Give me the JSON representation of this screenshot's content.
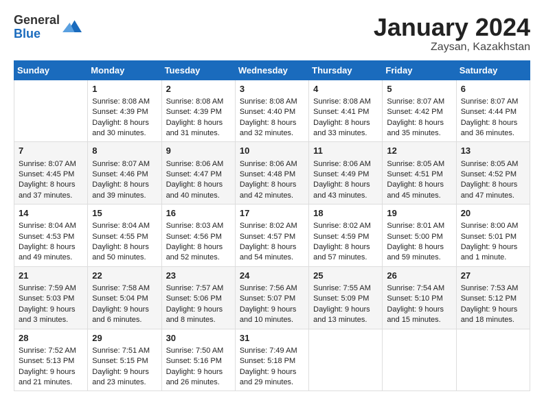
{
  "logo": {
    "general": "General",
    "blue": "Blue"
  },
  "title": "January 2024",
  "location": "Zaysan, Kazakhstan",
  "weekdays": [
    "Sunday",
    "Monday",
    "Tuesday",
    "Wednesday",
    "Thursday",
    "Friday",
    "Saturday"
  ],
  "weeks": [
    [
      {
        "day": "",
        "info": ""
      },
      {
        "day": "1",
        "info": "Sunrise: 8:08 AM\nSunset: 4:39 PM\nDaylight: 8 hours\nand 30 minutes."
      },
      {
        "day": "2",
        "info": "Sunrise: 8:08 AM\nSunset: 4:39 PM\nDaylight: 8 hours\nand 31 minutes."
      },
      {
        "day": "3",
        "info": "Sunrise: 8:08 AM\nSunset: 4:40 PM\nDaylight: 8 hours\nand 32 minutes."
      },
      {
        "day": "4",
        "info": "Sunrise: 8:08 AM\nSunset: 4:41 PM\nDaylight: 8 hours\nand 33 minutes."
      },
      {
        "day": "5",
        "info": "Sunrise: 8:07 AM\nSunset: 4:42 PM\nDaylight: 8 hours\nand 35 minutes."
      },
      {
        "day": "6",
        "info": "Sunrise: 8:07 AM\nSunset: 4:44 PM\nDaylight: 8 hours\nand 36 minutes."
      }
    ],
    [
      {
        "day": "7",
        "info": "Sunrise: 8:07 AM\nSunset: 4:45 PM\nDaylight: 8 hours\nand 37 minutes."
      },
      {
        "day": "8",
        "info": "Sunrise: 8:07 AM\nSunset: 4:46 PM\nDaylight: 8 hours\nand 39 minutes."
      },
      {
        "day": "9",
        "info": "Sunrise: 8:06 AM\nSunset: 4:47 PM\nDaylight: 8 hours\nand 40 minutes."
      },
      {
        "day": "10",
        "info": "Sunrise: 8:06 AM\nSunset: 4:48 PM\nDaylight: 8 hours\nand 42 minutes."
      },
      {
        "day": "11",
        "info": "Sunrise: 8:06 AM\nSunset: 4:49 PM\nDaylight: 8 hours\nand 43 minutes."
      },
      {
        "day": "12",
        "info": "Sunrise: 8:05 AM\nSunset: 4:51 PM\nDaylight: 8 hours\nand 45 minutes."
      },
      {
        "day": "13",
        "info": "Sunrise: 8:05 AM\nSunset: 4:52 PM\nDaylight: 8 hours\nand 47 minutes."
      }
    ],
    [
      {
        "day": "14",
        "info": "Sunrise: 8:04 AM\nSunset: 4:53 PM\nDaylight: 8 hours\nand 49 minutes."
      },
      {
        "day": "15",
        "info": "Sunrise: 8:04 AM\nSunset: 4:55 PM\nDaylight: 8 hours\nand 50 minutes."
      },
      {
        "day": "16",
        "info": "Sunrise: 8:03 AM\nSunset: 4:56 PM\nDaylight: 8 hours\nand 52 minutes."
      },
      {
        "day": "17",
        "info": "Sunrise: 8:02 AM\nSunset: 4:57 PM\nDaylight: 8 hours\nand 54 minutes."
      },
      {
        "day": "18",
        "info": "Sunrise: 8:02 AM\nSunset: 4:59 PM\nDaylight: 8 hours\nand 57 minutes."
      },
      {
        "day": "19",
        "info": "Sunrise: 8:01 AM\nSunset: 5:00 PM\nDaylight: 8 hours\nand 59 minutes."
      },
      {
        "day": "20",
        "info": "Sunrise: 8:00 AM\nSunset: 5:01 PM\nDaylight: 9 hours\nand 1 minute."
      }
    ],
    [
      {
        "day": "21",
        "info": "Sunrise: 7:59 AM\nSunset: 5:03 PM\nDaylight: 9 hours\nand 3 minutes."
      },
      {
        "day": "22",
        "info": "Sunrise: 7:58 AM\nSunset: 5:04 PM\nDaylight: 9 hours\nand 6 minutes."
      },
      {
        "day": "23",
        "info": "Sunrise: 7:57 AM\nSunset: 5:06 PM\nDaylight: 9 hours\nand 8 minutes."
      },
      {
        "day": "24",
        "info": "Sunrise: 7:56 AM\nSunset: 5:07 PM\nDaylight: 9 hours\nand 10 minutes."
      },
      {
        "day": "25",
        "info": "Sunrise: 7:55 AM\nSunset: 5:09 PM\nDaylight: 9 hours\nand 13 minutes."
      },
      {
        "day": "26",
        "info": "Sunrise: 7:54 AM\nSunset: 5:10 PM\nDaylight: 9 hours\nand 15 minutes."
      },
      {
        "day": "27",
        "info": "Sunrise: 7:53 AM\nSunset: 5:12 PM\nDaylight: 9 hours\nand 18 minutes."
      }
    ],
    [
      {
        "day": "28",
        "info": "Sunrise: 7:52 AM\nSunset: 5:13 PM\nDaylight: 9 hours\nand 21 minutes."
      },
      {
        "day": "29",
        "info": "Sunrise: 7:51 AM\nSunset: 5:15 PM\nDaylight: 9 hours\nand 23 minutes."
      },
      {
        "day": "30",
        "info": "Sunrise: 7:50 AM\nSunset: 5:16 PM\nDaylight: 9 hours\nand 26 minutes."
      },
      {
        "day": "31",
        "info": "Sunrise: 7:49 AM\nSunset: 5:18 PM\nDaylight: 9 hours\nand 29 minutes."
      },
      {
        "day": "",
        "info": ""
      },
      {
        "day": "",
        "info": ""
      },
      {
        "day": "",
        "info": ""
      }
    ]
  ]
}
